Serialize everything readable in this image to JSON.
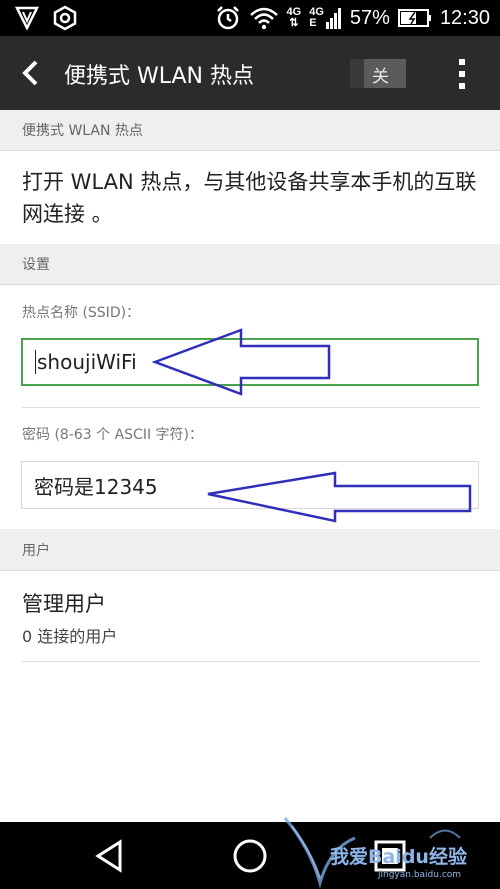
{
  "status_bar": {
    "battery": "57%",
    "time": "12:30",
    "network_type_1": "4G",
    "network_type_2": "4G",
    "signal_sub": "E"
  },
  "action_bar": {
    "title": "便携式 WLAN 热点",
    "toggle_label": "关"
  },
  "sections": {
    "hotspot_header": "便携式 WLAN 热点",
    "hotspot_description": "打开 WLAN 热点，与其他设备共享本手机的互联网连接 。",
    "settings_header": "设置",
    "users_header": "用户"
  },
  "settings": {
    "ssid_label": "热点名称 (SSID)：",
    "ssid_value": "shoujiWiFi",
    "password_label": "密码 (8-63 个 ASCII 字符)：",
    "password_value": "密码是12345"
  },
  "users": {
    "manage_title": "管理用户",
    "connected_count": "0 连接的用户"
  },
  "watermark": {
    "text": "我爱Baidu经验",
    "url": "jingyan.baidu.com"
  },
  "colors": {
    "action_bar": "#2b2b2b",
    "section_header_bg": "#efefef",
    "focus_border": "#4aa24f",
    "annotation_arrow": "#2f2fb8"
  }
}
